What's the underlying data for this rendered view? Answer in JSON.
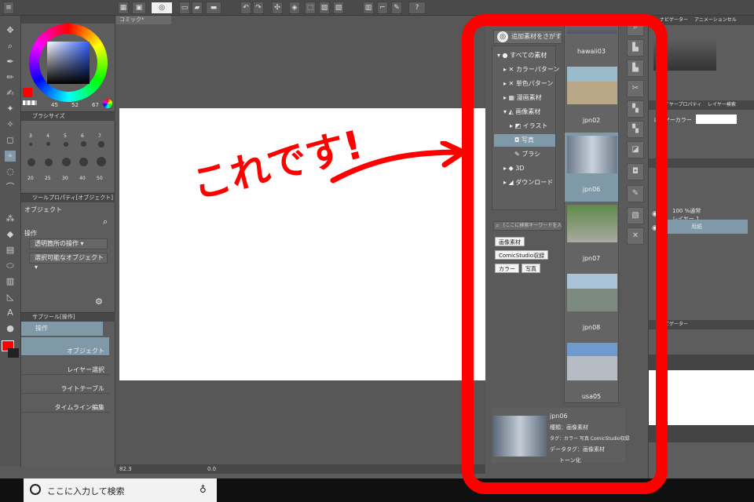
{
  "toolbar": {
    "help_icon": "?"
  },
  "document": {
    "tab_title": "コミック*",
    "zoom": "82.3",
    "rotation": "0.0"
  },
  "brush_size": {
    "title": "ブラシサイズ",
    "sizes": [
      "3",
      "4",
      "5",
      "6",
      "7",
      "20",
      "25",
      "30",
      "40",
      "50"
    ]
  },
  "color_values": [
    "45",
    "52",
    "67"
  ],
  "tool_property": {
    "title": "ツールプロパティ[オブジェクト]",
    "tool_name": "オブジェクト",
    "section": "操作",
    "options": [
      "透明箇所の操作",
      "選択可能なオブジェクト"
    ]
  },
  "sub_tool": {
    "title": "サブツール[操作]",
    "group": "操作",
    "items": [
      "オブジェクト",
      "レイヤー選択",
      "ライトテーブル",
      "タイムライン編集"
    ]
  },
  "material": {
    "search_button": "追加素材をさがす",
    "tree": [
      {
        "label": "すべての素材"
      },
      {
        "label": "カラーパターン"
      },
      {
        "label": "単色パターン"
      },
      {
        "label": "漫画素材"
      },
      {
        "label": "画像素材"
      },
      {
        "label": "イラスト"
      },
      {
        "label": "写真"
      },
      {
        "label": "ブラシ"
      },
      {
        "label": "3D"
      },
      {
        "label": "ダウンロード"
      }
    ],
    "search_placeholder": "[ここに検索キーワードを入",
    "tags": [
      "画像素材",
      "ComicStudio収録",
      "カラー",
      "写真"
    ],
    "thumbnails": [
      {
        "label": "hawaii03"
      },
      {
        "label": "jpn02"
      },
      {
        "label": "jpn06"
      },
      {
        "label": "jpn07"
      },
      {
        "label": "jpn08"
      },
      {
        "label": "usa05"
      }
    ],
    "detail": {
      "name": "jpn06",
      "type": "種類：画像素材",
      "tags": "タグ：カラー 写真 ComicStudio収録",
      "data_tags": "データタグ：画像素材",
      "tone": "トーン化"
    }
  },
  "right_panel": {
    "tabs": [
      "ナビゲーター",
      "アニメーションセル"
    ],
    "layer_property_title": "レイヤープロパティ",
    "layer_search_title": "レイヤー検索",
    "layer_color_label": "レイヤーカラー",
    "layer_blend": "100 %通常",
    "layer_name": "レイヤー 1",
    "paper_layer": "用紙",
    "navigator_title": "ナビゲーター"
  },
  "taskbar": {
    "search_placeholder": "ここに入力して検索"
  },
  "annotation": {
    "text": "これです!",
    "color": "#ff0000"
  }
}
